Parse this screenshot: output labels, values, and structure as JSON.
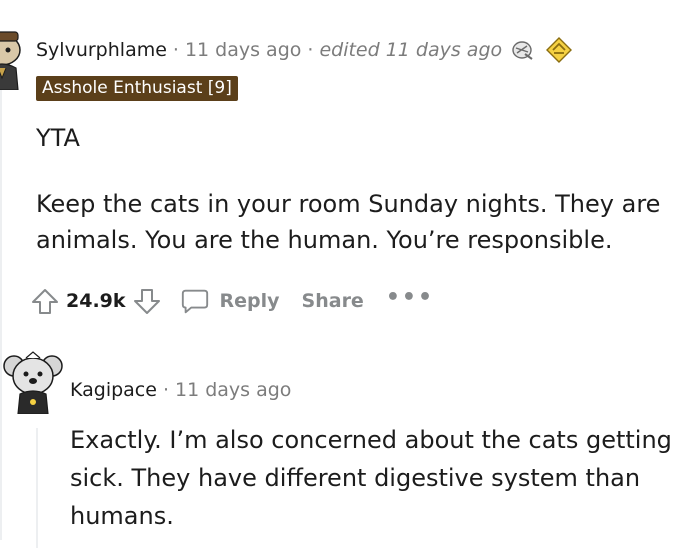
{
  "comment1": {
    "username": "Sylvurphlame",
    "time": "11 days ago",
    "edited": "edited 11 days ago",
    "flair": "Asshole Enthusiast [9]",
    "paragraphs": [
      "YTA",
      "Keep the cats in your room Sunday nights. They are",
      "animals. You are the human. You’re responsible."
    ],
    "score": "24.9k",
    "actions": {
      "reply": "Reply",
      "share": "Share",
      "more": "•••"
    },
    "icons": [
      "avatar",
      "upvote-icon",
      "downvote-icon",
      "comment-icon",
      "award-icon",
      "gold-award-icon"
    ]
  },
  "comment2": {
    "username": "Kagipace",
    "time": "11 days ago",
    "lines": [
      "Exactly. I’m also concerned about the cats getting",
      "sick. They have different digestive system than",
      "humans."
    ]
  },
  "colors": {
    "flair_bg": "#5b3f1a",
    "meta_grey": "#7c7c7c",
    "action_grey": "#878a8c",
    "text": "#1c1c1c"
  }
}
